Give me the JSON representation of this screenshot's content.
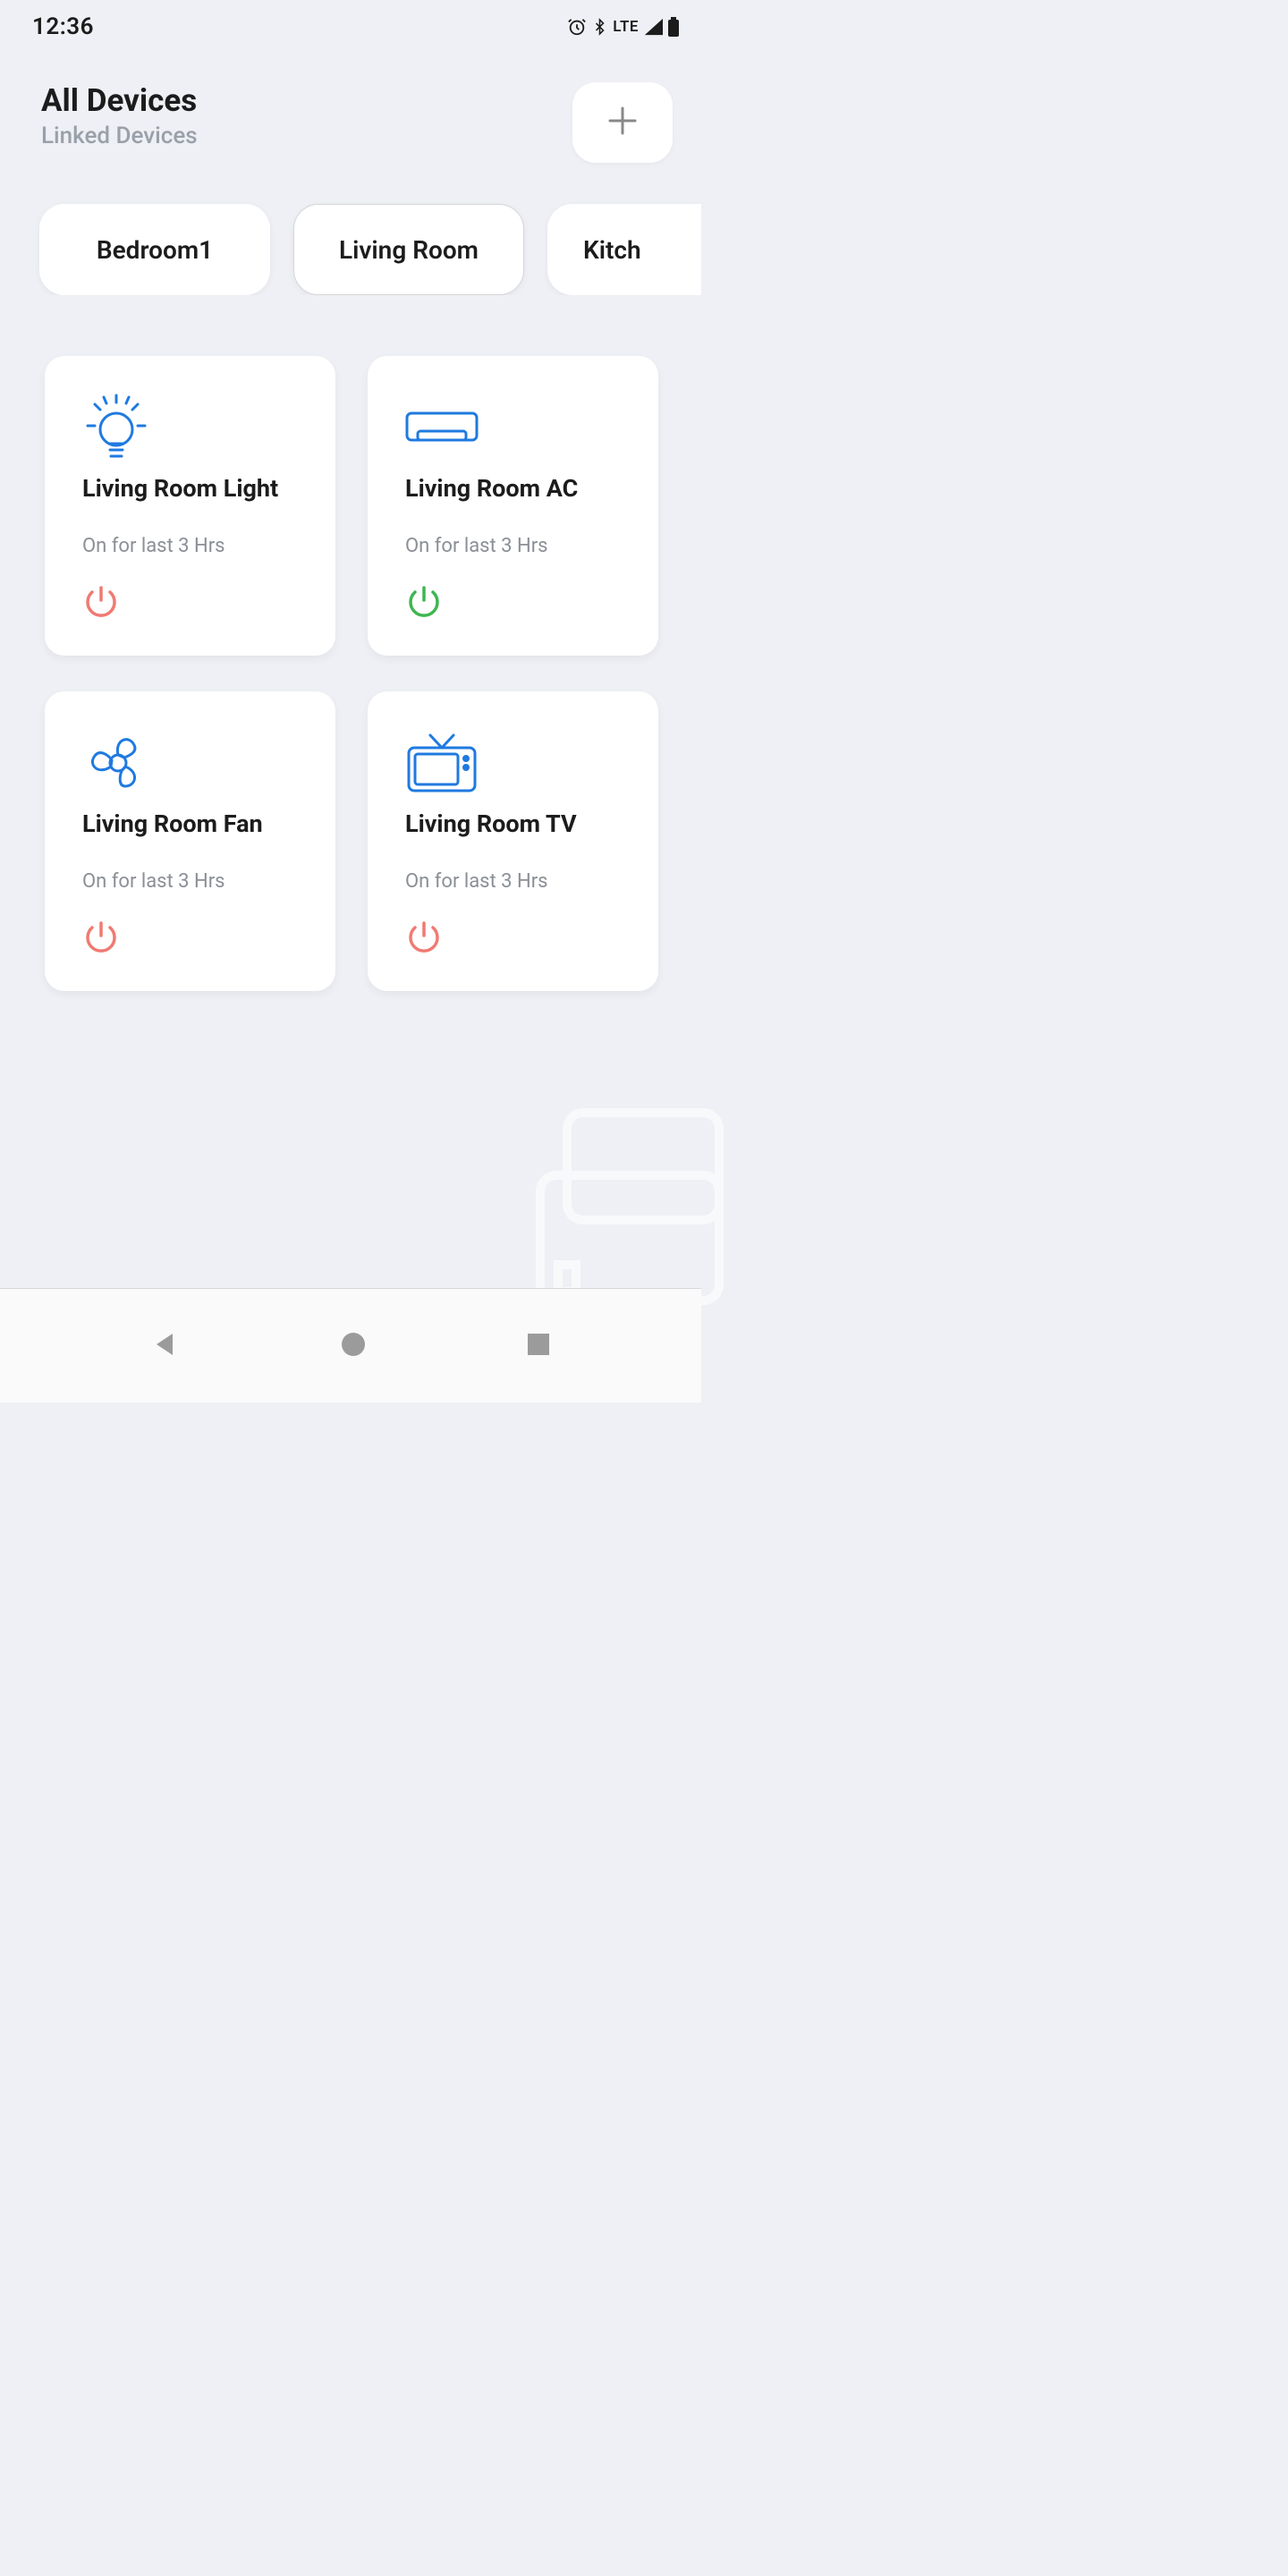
{
  "status": {
    "time": "12:36",
    "network": "LTE"
  },
  "header": {
    "title": "All Devices",
    "subtitle": "Linked Devices"
  },
  "rooms": [
    {
      "label": "Bedroom1"
    },
    {
      "label": "Living Room"
    },
    {
      "label": "Kitch"
    }
  ],
  "devices": [
    {
      "name": "Living Room Light",
      "status": "On for last 3 Hrs",
      "power_color": "#f07a72",
      "icon": "lightbulb"
    },
    {
      "name": "Living Room AC",
      "status": "On for last 3 Hrs",
      "power_color": "#3eb651",
      "icon": "ac"
    },
    {
      "name": "Living Room Fan",
      "status": "On for last 3 Hrs",
      "power_color": "#f07a72",
      "icon": "fan"
    },
    {
      "name": "Living Room TV",
      "status": "On for last 3 Hrs",
      "power_color": "#f07a72",
      "icon": "tv"
    }
  ],
  "colors": {
    "accent": "#1f7ae0"
  }
}
